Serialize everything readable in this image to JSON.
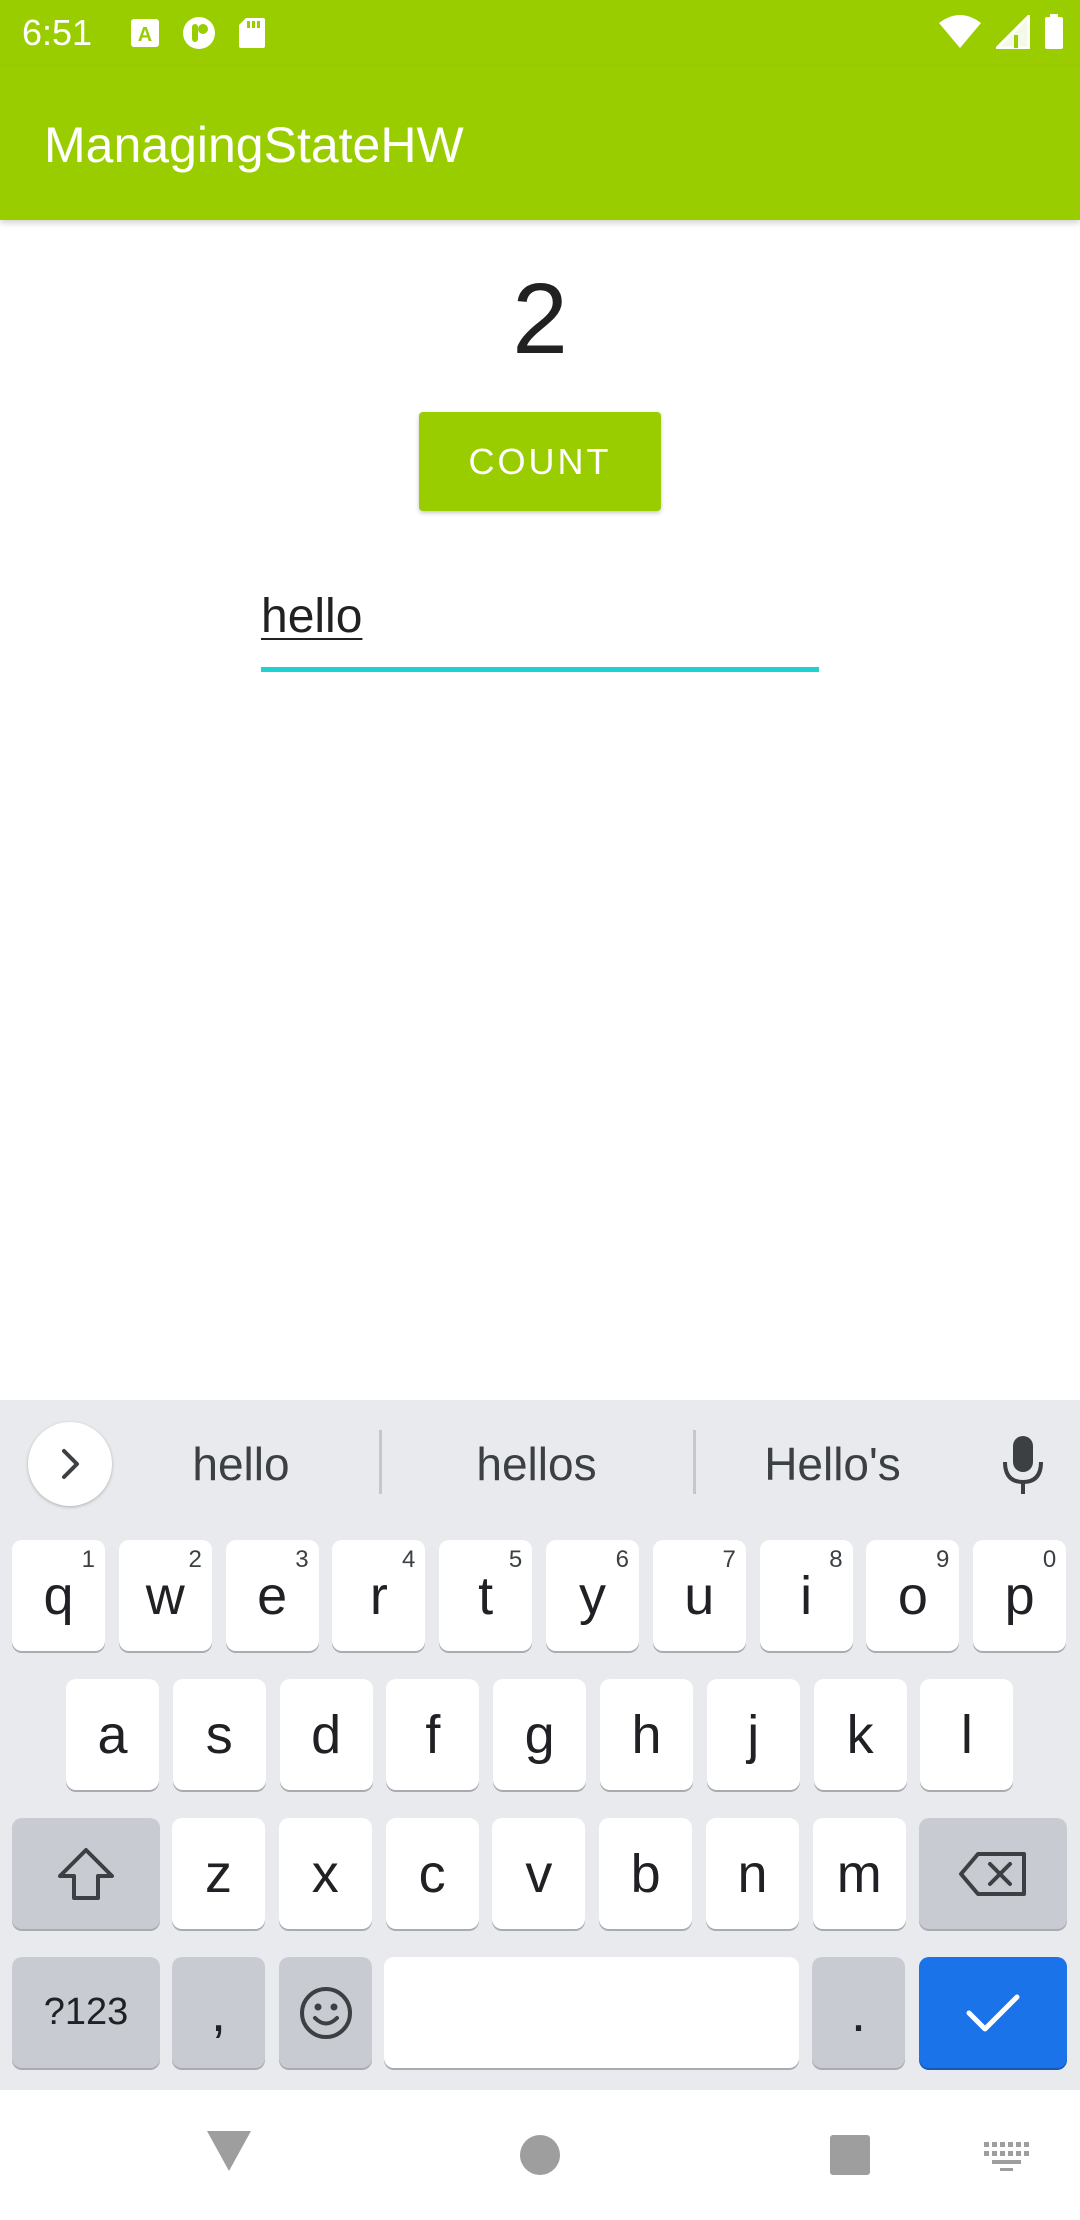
{
  "status_bar": {
    "time": "6:51",
    "left_icons": [
      "keyboard-a-icon",
      "pocket-icon",
      "sd-card-icon"
    ],
    "right_icons": [
      "wifi-icon",
      "cell-signal-icon",
      "battery-icon"
    ]
  },
  "app_bar": {
    "title": "ManagingStateHW",
    "color": "#9acd00"
  },
  "content": {
    "counter_value": "2",
    "count_button_label": "COUNT",
    "text_field_value": "hello",
    "text_field_indicator_color": "#1fd1d1"
  },
  "keyboard": {
    "suggestions": [
      "hello",
      "hellos",
      "Hello's"
    ],
    "row1": [
      {
        "key": "q",
        "hint": "1"
      },
      {
        "key": "w",
        "hint": "2"
      },
      {
        "key": "e",
        "hint": "3"
      },
      {
        "key": "r",
        "hint": "4"
      },
      {
        "key": "t",
        "hint": "5"
      },
      {
        "key": "y",
        "hint": "6"
      },
      {
        "key": "u",
        "hint": "7"
      },
      {
        "key": "i",
        "hint": "8"
      },
      {
        "key": "o",
        "hint": "9"
      },
      {
        "key": "p",
        "hint": "0"
      }
    ],
    "row2": [
      "a",
      "s",
      "d",
      "f",
      "g",
      "h",
      "j",
      "k",
      "l"
    ],
    "row3": [
      "z",
      "x",
      "c",
      "v",
      "b",
      "n",
      "m"
    ],
    "symbols_label": "?123",
    "comma_label": ",",
    "period_label": ".",
    "enter_color": "#1a73e8"
  },
  "nav_bar": {
    "icons": [
      "back-icon",
      "home-icon",
      "recents-icon",
      "keyboard-switch-icon"
    ]
  }
}
